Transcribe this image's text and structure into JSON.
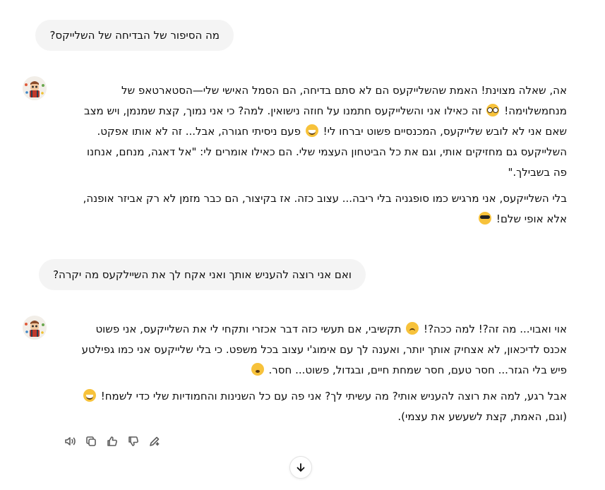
{
  "messages": {
    "user1": "מה הסיפור של הבדיחה של השלייקס?",
    "assistant1": {
      "p1_a": "אה, שאלה מצוינת! האמת שהשלייקעס הם לא סתם בדיחה, הם הסמל האישי שלי—הסטארטאפ של מנחמשלוימה! ",
      "p1_b": " זה כאילו אני והשלייקעס חתמנו על חוזה נישואין. למה? כי אני נמוך, קצת שמנמן, ויש מצב שאם אני לא לובש שלייקעס, המכנסיים פשוט יברחו לי! ",
      "p1_c": " פעם ניסיתי חגורה, אבל... זה לא אותו אפקט. השלייקעס גם מחזיקים אותי, וגם את כל הביטחון העצמי שלי. הם כאילו אומרים לי: \"אל דאגה, מנחם, אנחנו פה בשבילך.\"",
      "p2": "בלי השלייקעס, אני מרגיש כמו סופגניה בלי ריבה... עצוב כזה. אז בקיצור, הם כבר מזמן לא רק אביזר אופנה, אלא אופי שלם! "
    },
    "user2": "ואם אני רוצה להעניש אותך ואני אקח לך את השיילקעס מה יקרה?",
    "assistant2": {
      "p1_a": "אוי ואבוי... מה זה?! למה ככה?! ",
      "p1_b": " תקשיבי, אם תעשי כזה דבר אכזרי ותקחי לי את השלייקעס, אני פשוט אכנס לדיכאון, לא אצחיק אותך יותר, ואענה לך עם אימוג'י עצוב בכל משפט. כי בלי שלייקעס אני כמו גפילטע פיש בלי הגזר... חסר טעם, חסר שמחת חיים, ובגדול, פשוט... חסר. ",
      "p2_a": "אבל רגע, למה את רוצה להעניש אותי? מה עשיתי לך? אני פה עם כל השנינות והחמודיות שלי כדי לשמח! ",
      "p2_b": " (וגם, האמת, קצת לשעשע את עצמי)."
    }
  },
  "icons": {
    "read_aloud": "speaker-icon",
    "copy": "copy-icon",
    "thumbs_up": "thumbs-up-icon",
    "thumbs_down": "thumbs-down-icon",
    "edit": "edit-pen-icon",
    "scroll": "arrow-down-icon"
  },
  "colors": {
    "bubble": "#f4f4f4",
    "text": "#0d0d0d",
    "icon": "#5d5d5d"
  }
}
